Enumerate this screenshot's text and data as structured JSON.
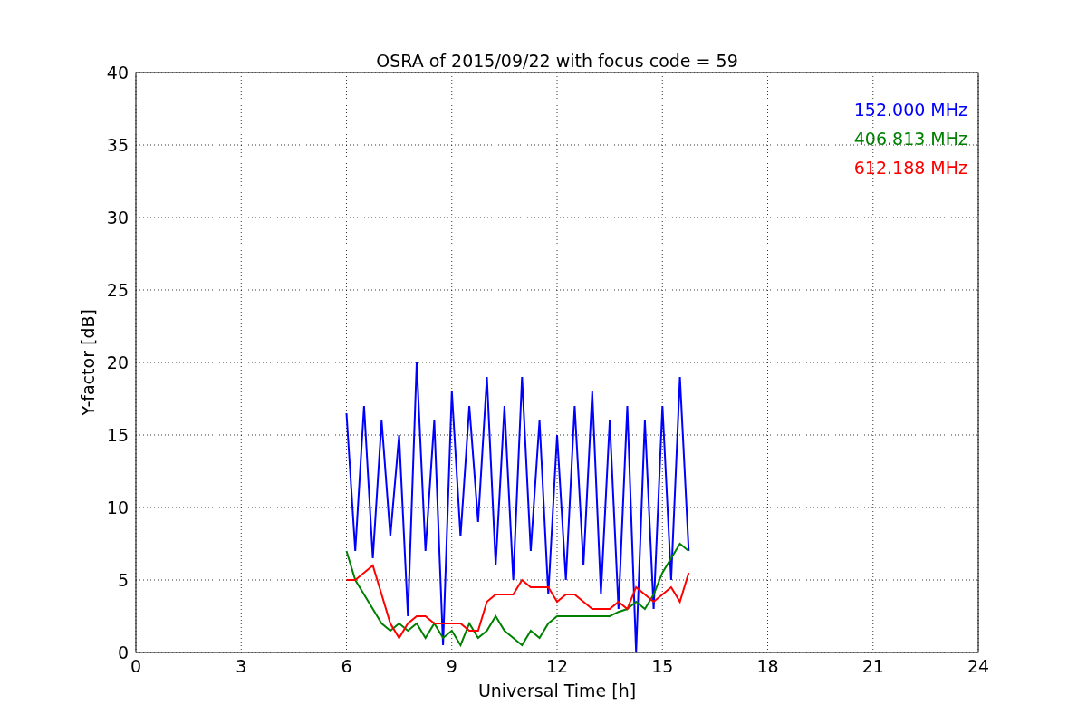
{
  "chart_data": {
    "type": "line",
    "title": "OSRA of 2015/09/22 with focus code = 59",
    "xlabel": "Universal Time [h]",
    "ylabel": "Y-factor [dB]",
    "x": [
      6.0,
      6.25,
      6.5,
      6.75,
      7.0,
      7.25,
      7.5,
      7.75,
      8.0,
      8.25,
      8.5,
      8.75,
      9.0,
      9.25,
      9.5,
      9.75,
      10.0,
      10.25,
      10.5,
      10.75,
      11.0,
      11.25,
      11.5,
      11.75,
      12.0,
      12.25,
      12.5,
      12.75,
      13.0,
      13.25,
      13.5,
      13.75,
      14.0,
      14.25,
      14.5,
      14.75,
      15.0,
      15.25,
      15.5,
      15.75
    ],
    "series": [
      {
        "name": "152.000 MHz",
        "color": "#0000ff",
        "values": [
          16.5,
          7,
          17,
          6.5,
          16,
          8,
          15,
          2.5,
          20,
          7,
          16,
          0.5,
          18,
          8,
          17,
          9,
          19,
          6,
          17,
          5,
          19,
          7,
          16,
          4,
          15,
          5,
          17,
          6,
          18,
          4,
          16,
          3,
          17,
          0,
          16,
          3,
          17,
          5,
          19,
          7
        ]
      },
      {
        "name": "406.813 MHz",
        "color": "#008000",
        "values": [
          7,
          5,
          4,
          3,
          2,
          1.5,
          2,
          1.5,
          2,
          1,
          2,
          1,
          1.5,
          0.5,
          2,
          1,
          1.5,
          2.5,
          1.5,
          1,
          0.5,
          1.5,
          1,
          2,
          2.5,
          2.5,
          2.5,
          2.5,
          2.5,
          2.5,
          2.5,
          2.8,
          3,
          3.5,
          3,
          4,
          5.5,
          6.5,
          7.5,
          7
        ]
      },
      {
        "name": "612.188 MHz",
        "color": "#ff0000",
        "values": [
          5,
          5,
          5.5,
          6,
          4,
          2,
          1,
          2,
          2.5,
          2.5,
          2,
          2,
          2,
          2,
          1.5,
          1.5,
          3.5,
          4,
          4,
          4,
          5,
          4.5,
          4.5,
          4.5,
          3.5,
          4,
          4,
          3.5,
          3,
          3,
          3,
          3.5,
          3,
          4.5,
          4,
          3.5,
          4,
          4.5,
          3.5,
          5.5
        ]
      }
    ],
    "xlim": [
      0,
      24
    ],
    "ylim": [
      0,
      40
    ],
    "xticks": [
      0,
      3,
      6,
      9,
      12,
      15,
      18,
      21,
      24
    ],
    "yticks": [
      0,
      5,
      10,
      15,
      20,
      25,
      30,
      35,
      40
    ],
    "grid": true
  }
}
